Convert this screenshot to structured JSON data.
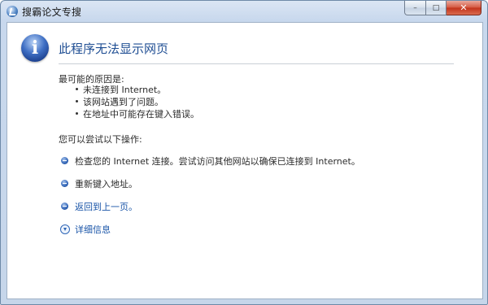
{
  "window": {
    "title": "搜霸论文专搜",
    "controls": {
      "minimize": "–",
      "maximize": "□",
      "close": "✕"
    }
  },
  "error": {
    "icon_glyph": "i",
    "heading": "此程序无法显示网页",
    "causes_label": "最可能的原因是:",
    "causes": [
      "未连接到 Internet。",
      "该网站遇到了问题。",
      "在地址中可能存在键入错误。"
    ],
    "actions_label": "您可以尝试以下操作:",
    "actions": [
      "检查您的 Internet 连接。尝试访问其他网站以确保已连接到 Internet。",
      "重新键入地址。",
      "返回到上一页。"
    ],
    "more_info": "详细信息"
  }
}
